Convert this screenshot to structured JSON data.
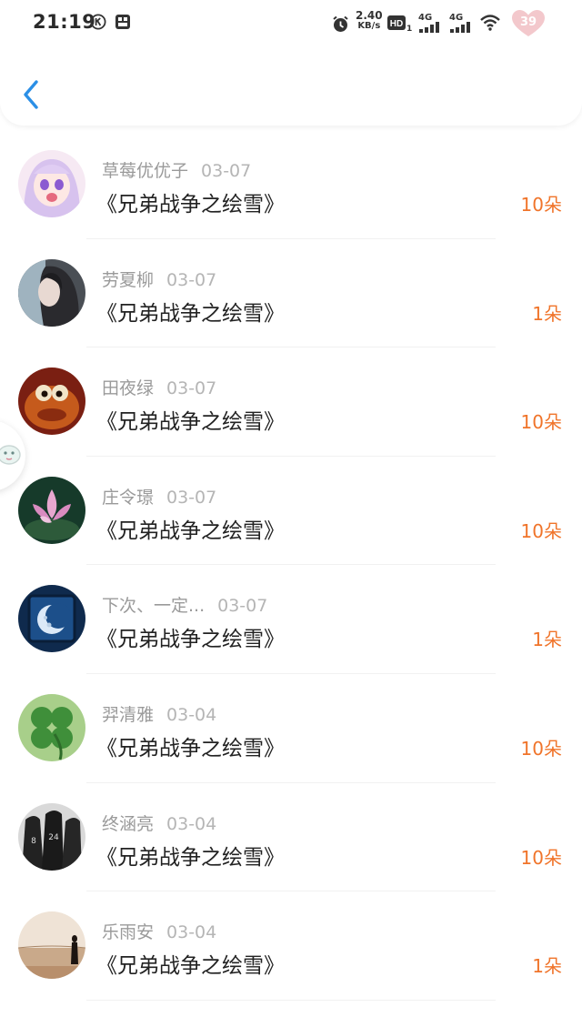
{
  "status_bar": {
    "time": "21:19",
    "speed_value": "2.40",
    "speed_unit": "KB/s",
    "hd_sub": "1",
    "net1": "4G",
    "net2": "4G",
    "battery": "39",
    "icons": [
      "k-circle-icon",
      "gallery-icon",
      "alarm-icon",
      "hd-icon",
      "signal-icon",
      "signal-icon",
      "wifi-icon",
      "battery-heart-icon"
    ]
  },
  "header": {
    "back_icon": "chevron-left-icon",
    "accent_color": "#2b8fe6"
  },
  "list": {
    "count_color": "#f0742a",
    "items": [
      {
        "user": "草莓优优子",
        "date": "03-07",
        "title": "《兄弟战争之绘雪》",
        "count": "10朵"
      },
      {
        "user": "劳夏柳",
        "date": "03-07",
        "title": "《兄弟战争之绘雪》",
        "count": "1朵"
      },
      {
        "user": "田夜绿",
        "date": "03-07",
        "title": "《兄弟战争之绘雪》",
        "count": "10朵"
      },
      {
        "user": "庄令璟",
        "date": "03-07",
        "title": "《兄弟战争之绘雪》",
        "count": "10朵"
      },
      {
        "user": "下次、一定...",
        "date": "03-07",
        "title": "《兄弟战争之绘雪》",
        "count": "1朵"
      },
      {
        "user": "羿清雅",
        "date": "03-04",
        "title": "《兄弟战争之绘雪》",
        "count": "10朵"
      },
      {
        "user": "终涵亮",
        "date": "03-04",
        "title": "《兄弟战争之绘雪》",
        "count": "10朵"
      },
      {
        "user": "乐雨安",
        "date": "03-04",
        "title": "《兄弟战争之绘雪》",
        "count": "1朵"
      }
    ]
  }
}
